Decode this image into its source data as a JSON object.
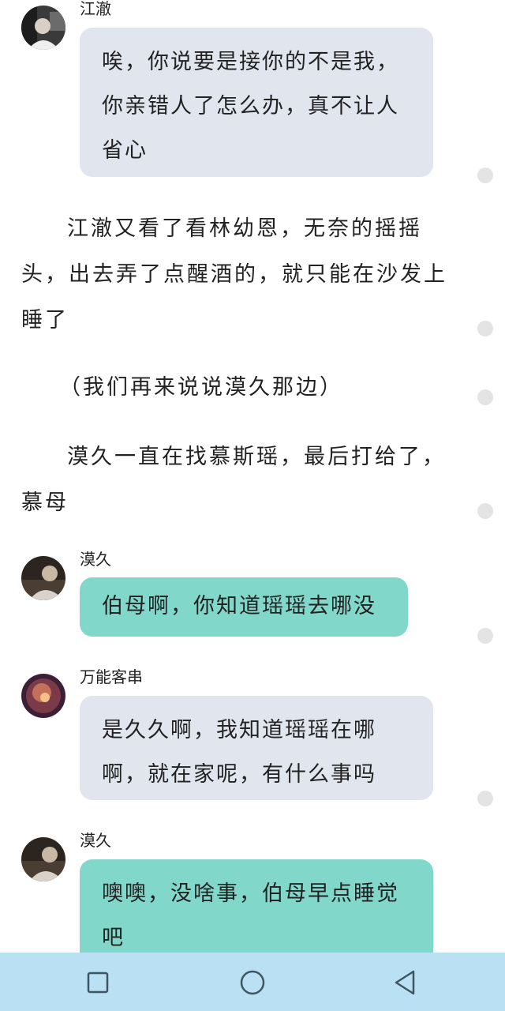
{
  "messages": [
    {
      "type": "bubble",
      "sender": "江澈",
      "text": "唉，你说要是接你的不是我，你亲错人了怎么办，真不让人省心",
      "lines": [
        "唉，你说要是接你的不是我，",
        "你亲错人了怎么办，真不让人",
        "省心"
      ]
    },
    {
      "type": "narration",
      "text": "江澈又看了看林幼恩，无奈的摇摇头，出去弄了点醒酒的，就只能在沙发上睡了"
    },
    {
      "type": "narration",
      "text": "（我们再来说说漠久那边）"
    },
    {
      "type": "narration",
      "text": "漠久一直在找慕斯瑶，最后打给了，慕母"
    },
    {
      "type": "bubble",
      "sender": "漠久",
      "text": "伯母啊，你知道瑶瑶去哪没",
      "lines": [
        "伯母啊，你知道瑶瑶去哪没"
      ]
    },
    {
      "type": "bubble",
      "sender": "万能客串",
      "text": "是久久啊，我知道瑶瑶在哪啊，就在家呢，有什么事吗",
      "lines": [
        "是久久啊，我知道瑶瑶在哪",
        "啊，就在家呢，有什么事吗"
      ]
    },
    {
      "type": "bubble",
      "sender": "漠久",
      "text": "噢噢，没啥事，伯母早点睡觉吧",
      "lines": [
        "噢噢，没啥事，伯母早点睡觉",
        "吧"
      ]
    }
  ],
  "navbar": {
    "buttons": [
      "square-recents-icon",
      "circle-home-icon",
      "triangle-back-icon"
    ]
  },
  "colors": {
    "bubble_gray": "#e1e5ee",
    "bubble_teal": "#82d7cb",
    "navbar": "#b9e0f3",
    "nav_icon": "#3f5563"
  }
}
